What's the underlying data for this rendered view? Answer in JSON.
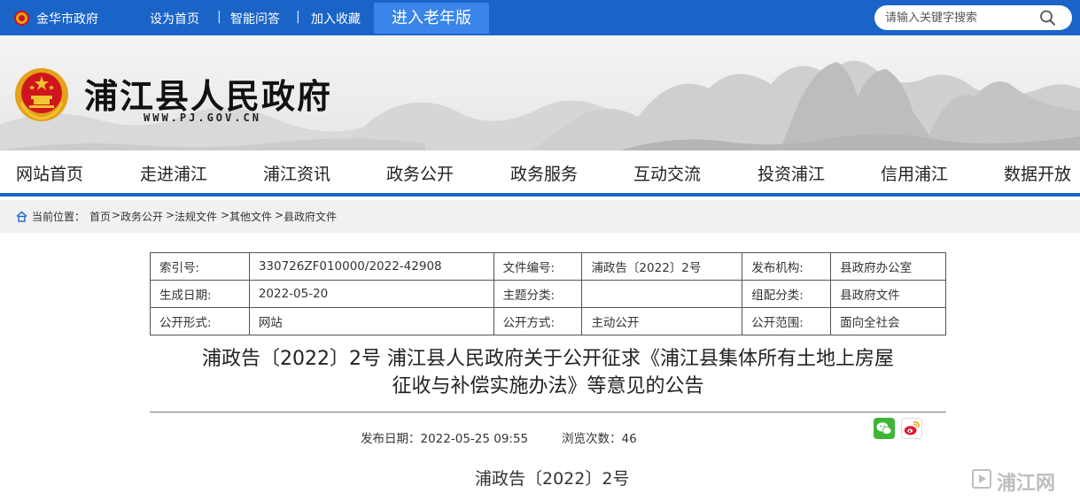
{
  "topbar": {
    "city_link": "金华市政府",
    "set_home": "设为首页",
    "smart_qa": "智能问答",
    "add_favorite": "加入收藏",
    "separator": "|",
    "elder_mode": "进入老年版",
    "search_placeholder": "请输入关键字搜索",
    "colors": {
      "bar": "#1a64c8",
      "elder_button": "#3a85ea"
    }
  },
  "banner": {
    "title": "浦江县人民政府",
    "url": "WWW.PJ.GOV.CN"
  },
  "nav": {
    "items": [
      "网站首页",
      "走进浦江",
      "浦江资讯",
      "政务公开",
      "政务服务",
      "互动交流",
      "投资浦江",
      "信用浦江",
      "数据开放"
    ]
  },
  "breadcrumb": {
    "label": "当前位置：",
    "items": [
      "首页",
      "政务公开",
      "法规文件",
      "其他文件",
      "县政府文件"
    ],
    "separator": ">"
  },
  "meta": {
    "rows": [
      [
        "索引号:",
        "330726ZF010000/2022-42908",
        "文件编号:",
        "浦政告〔2022〕2号",
        "发布机构:",
        "县政府办公室"
      ],
      [
        "生成日期:",
        "2022-05-20",
        "主题分类:",
        "",
        "组配分类:",
        "县政府文件"
      ],
      [
        "公开形式:",
        "网站",
        "公开方式:",
        "主动公开",
        "公开范围:",
        "面向全社会"
      ]
    ]
  },
  "article": {
    "title_line1": "浦政告〔2022〕2号 浦江县人民政府关于公开征求《浦江县集体所有土地上房屋",
    "title_line2": "征收与补偿实施办法》等意见的公告",
    "published": "发布日期：2022-05-25 09:55",
    "views": "浏览次数：46",
    "doc_number": "浦政告〔2022〕2号"
  },
  "watermark": "浦江网"
}
